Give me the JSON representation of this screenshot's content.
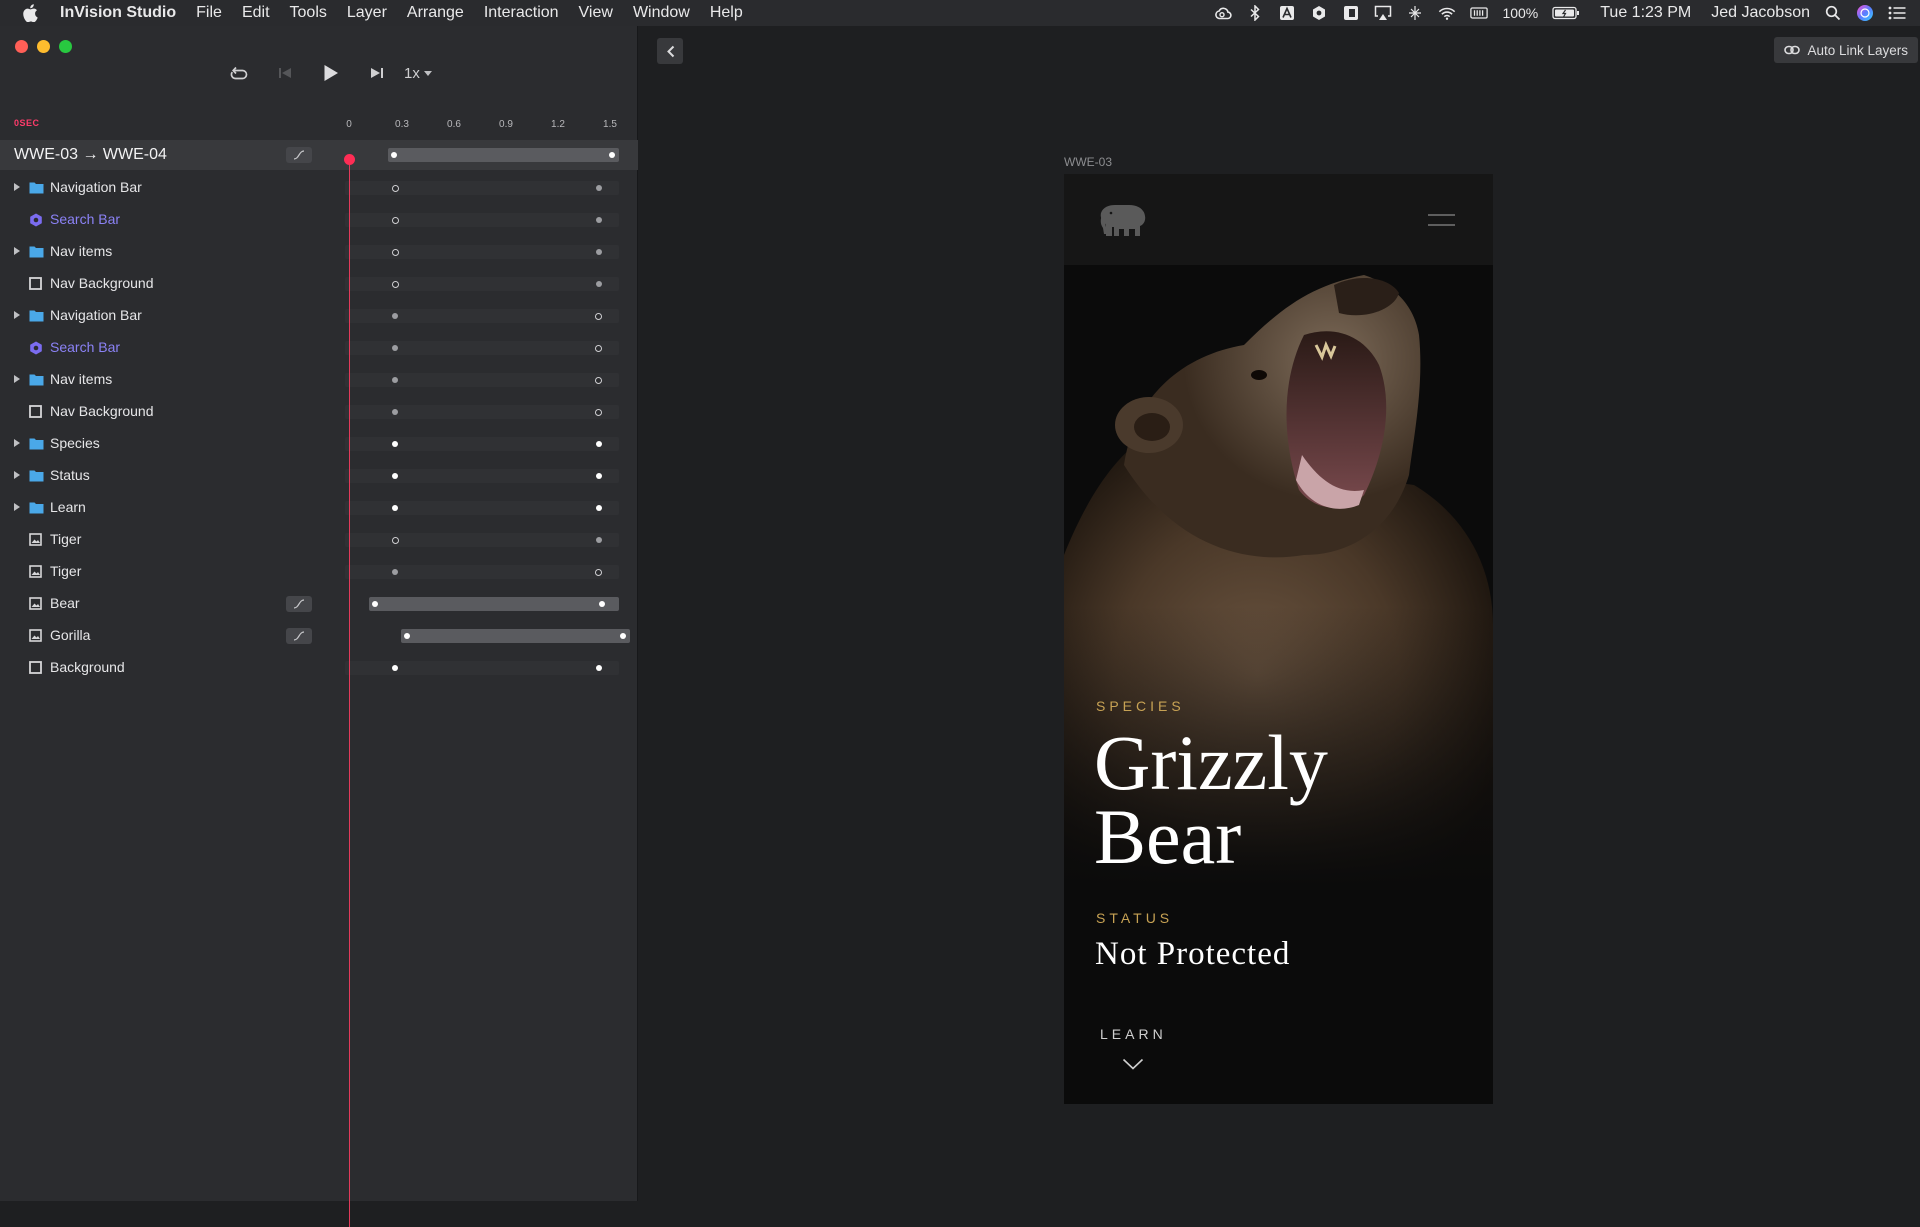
{
  "menubar": {
    "app_name": "InVision Studio",
    "menus": [
      "File",
      "Edit",
      "Tools",
      "Layer",
      "Arrange",
      "Interaction",
      "View",
      "Window",
      "Help"
    ],
    "battery": "100%",
    "clock": "Tue 1:23 PM",
    "user": "Jed Jacobson"
  },
  "timeline": {
    "speed": "1x",
    "ruler_label": "0SEC",
    "ticks": [
      "0",
      "0.3",
      "0.6",
      "0.9",
      "1.2",
      "1.5"
    ],
    "transition_title": "WWE-03 → WWE-04",
    "layers": [
      {
        "name": "Navigation Bar",
        "icon": "folder-icon",
        "expand": true,
        "purple": false
      },
      {
        "name": "Search Bar",
        "icon": "component-icon",
        "expand": false,
        "purple": true
      },
      {
        "name": "Nav items",
        "icon": "folder-icon",
        "expand": true,
        "purple": false
      },
      {
        "name": "Nav Background",
        "icon": "rectangle-icon",
        "expand": false,
        "purple": false
      },
      {
        "name": "Navigation Bar",
        "icon": "folder-icon",
        "expand": true,
        "purple": false
      },
      {
        "name": "Search Bar",
        "icon": "component-icon",
        "expand": false,
        "purple": true
      },
      {
        "name": "Nav items",
        "icon": "folder-icon",
        "expand": true,
        "purple": false
      },
      {
        "name": "Nav Background",
        "icon": "rectangle-icon",
        "expand": false,
        "purple": false
      },
      {
        "name": "Species",
        "icon": "folder-icon",
        "expand": true,
        "purple": false
      },
      {
        "name": "Status",
        "icon": "folder-icon",
        "expand": true,
        "purple": false
      },
      {
        "name": "Learn",
        "icon": "folder-icon",
        "expand": true,
        "purple": false
      },
      {
        "name": "Tiger",
        "icon": "image-icon",
        "expand": false,
        "purple": false
      },
      {
        "name": "Tiger",
        "icon": "image-icon",
        "expand": false,
        "purple": false
      },
      {
        "name": "Bear",
        "icon": "image-icon",
        "expand": false,
        "purple": false
      },
      {
        "name": "Gorilla",
        "icon": "image-icon",
        "expand": false,
        "purple": false
      },
      {
        "name": "Background",
        "icon": "rectangle-icon",
        "expand": false,
        "purple": false
      }
    ]
  },
  "canvas": {
    "auto_link_label": "Auto Link Layers",
    "artboard_name": "WWE-03",
    "species_label": "SPECIES",
    "species_name": "Grizzly Bear",
    "status_label": "STATUS",
    "status_value": "Not Protected",
    "learn_label": "LEARN"
  },
  "colors": {
    "accent_gold": "#c7a254",
    "playhead": "#ff2d55",
    "component_purple": "#8b82f5",
    "folder_blue": "#4aa8e8"
  }
}
